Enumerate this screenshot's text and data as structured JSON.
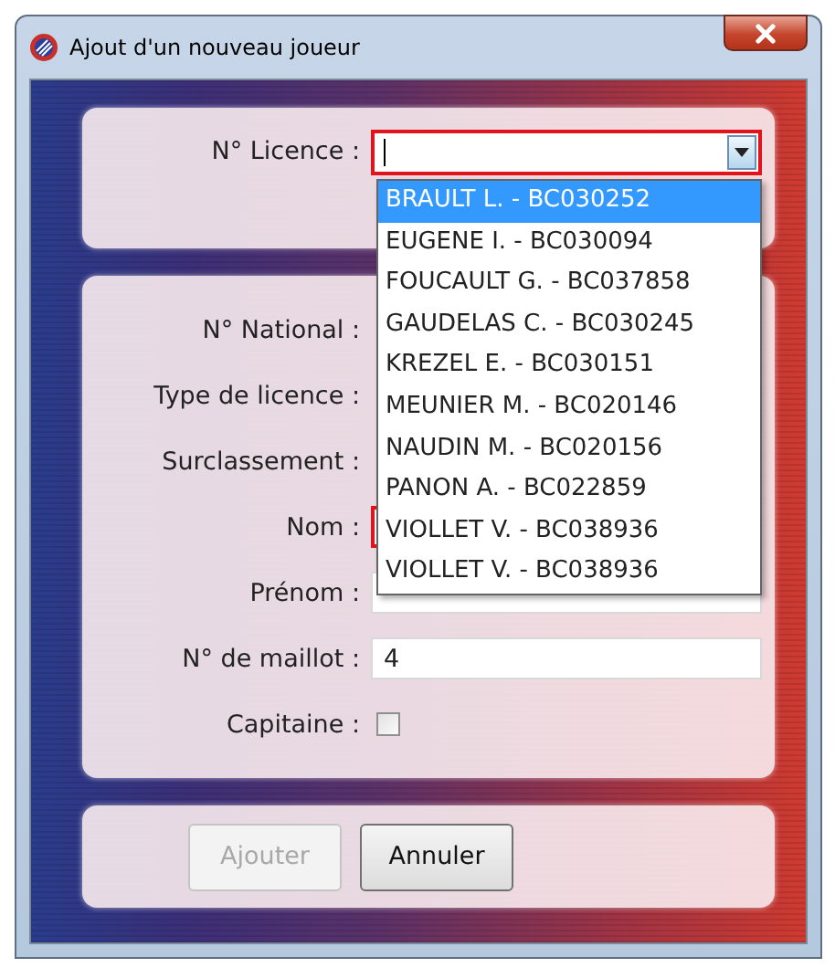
{
  "window": {
    "title": "Ajout d'un nouveau joueur"
  },
  "licence": {
    "label": "N° Licence :",
    "invalid": true,
    "expanded": true
  },
  "dropdown": [
    {
      "text": "BRAULT L. - BC030252",
      "selected": true
    },
    {
      "text": "EUGENE I. - BC030094",
      "selected": false
    },
    {
      "text": "FOUCAULT G. - BC037858",
      "selected": false
    },
    {
      "text": "GAUDELAS C. - BC030245",
      "selected": false
    },
    {
      "text": "KREZEL E. - BC030151",
      "selected": false
    },
    {
      "text": "MEUNIER M. - BC020146",
      "selected": false
    },
    {
      "text": "NAUDIN M. - BC020156",
      "selected": false
    },
    {
      "text": "PANON A. - BC022859",
      "selected": false
    },
    {
      "text": "VIOLLET V. - BC038936",
      "selected": false
    },
    {
      "text": "VIOLLET V. - BC038936",
      "selected": false
    }
  ],
  "fields": [
    {
      "label": "N° National :",
      "kind": "covered"
    },
    {
      "label": "Type de licence :",
      "kind": "covered"
    },
    {
      "label": "Surclassement :",
      "kind": "covered"
    },
    {
      "label": "Nom :",
      "kind": "text",
      "invalid": true
    },
    {
      "label": "Prénom :",
      "kind": "text",
      "invalid": false
    },
    {
      "label": "N° de maillot :",
      "kind": "text",
      "value": "4",
      "invalid": false
    },
    {
      "label": "Capitaine :",
      "kind": "checkbox",
      "checked": false
    }
  ],
  "buttons": [
    {
      "label": "Ajouter",
      "disabled": true
    },
    {
      "label": "Annuler",
      "disabled": false
    }
  ]
}
